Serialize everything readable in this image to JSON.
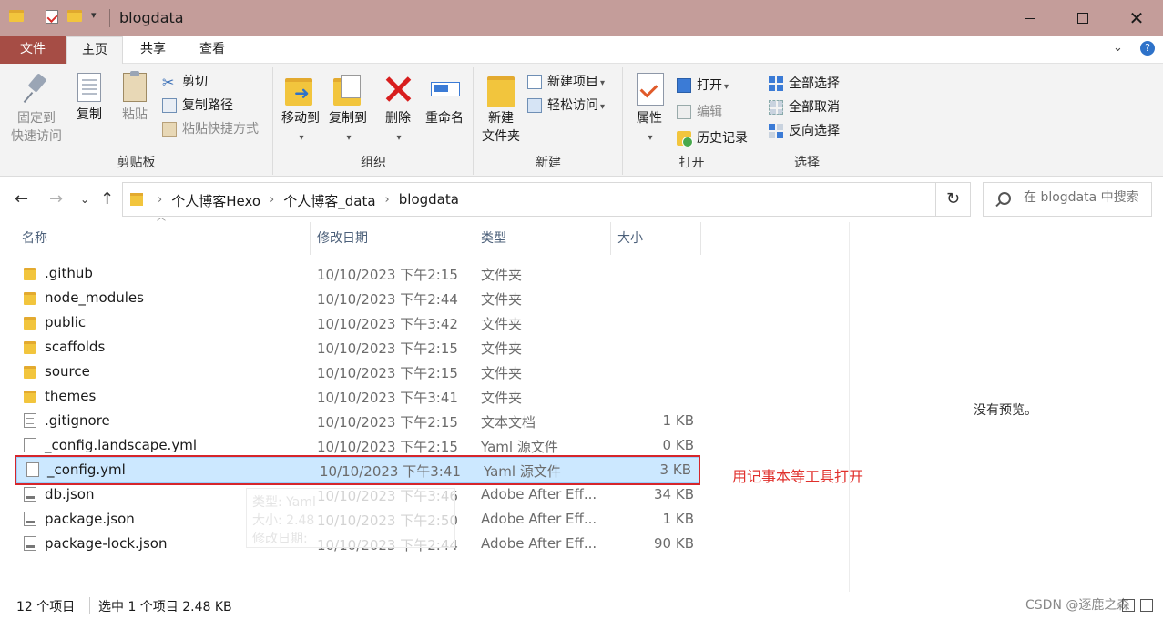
{
  "window": {
    "title": "blogdata",
    "close_glyph": "✕",
    "quick_access_down": "▾"
  },
  "tabs": {
    "file": "文件",
    "home": "主页",
    "share": "共享",
    "view": "查看"
  },
  "ribbon": {
    "clipboard": {
      "label": "剪贴板",
      "pin": "固定到\n快速访问",
      "pin_line1": "固定到",
      "pin_line2": "快速访问",
      "copy": "复制",
      "paste": "粘贴",
      "cut": "剪切",
      "copy_path": "复制路径",
      "paste_shortcut": "粘贴快捷方式"
    },
    "organize": {
      "label": "组织",
      "move_to": "移动到",
      "copy_to": "复制到",
      "delete": "删除",
      "rename": "重命名"
    },
    "new": {
      "label": "新建",
      "new_folder_line1": "新建",
      "new_folder_line2": "文件夹",
      "new_item": "新建项目",
      "easy_access": "轻松访问"
    },
    "open": {
      "label": "打开",
      "properties": "属性",
      "open": "打开",
      "edit": "编辑",
      "history": "历史记录"
    },
    "select": {
      "label": "选择",
      "select_all": "全部选择",
      "select_none": "全部取消",
      "invert": "反向选择"
    }
  },
  "address": {
    "crumbs": [
      "个人博客Hexo",
      "个人博客_data",
      "blogdata"
    ],
    "search_placeholder": "在 blogdata 中搜索"
  },
  "columns": {
    "name": "名称",
    "date": "修改日期",
    "type": "类型",
    "size": "大小"
  },
  "files": [
    {
      "name": ".github",
      "date": "10/10/2023 下午2:15",
      "type": "文件夹",
      "size": "",
      "icon": "folder"
    },
    {
      "name": "node_modules",
      "date": "10/10/2023 下午2:44",
      "type": "文件夹",
      "size": "",
      "icon": "folder"
    },
    {
      "name": "public",
      "date": "10/10/2023 下午3:42",
      "type": "文件夹",
      "size": "",
      "icon": "folder"
    },
    {
      "name": "scaffolds",
      "date": "10/10/2023 下午2:15",
      "type": "文件夹",
      "size": "",
      "icon": "folder"
    },
    {
      "name": "source",
      "date": "10/10/2023 下午2:15",
      "type": "文件夹",
      "size": "",
      "icon": "folder"
    },
    {
      "name": "themes",
      "date": "10/10/2023 下午3:41",
      "type": "文件夹",
      "size": "",
      "icon": "folder"
    },
    {
      "name": ".gitignore",
      "date": "10/10/2023 下午2:15",
      "type": "文本文档",
      "size": "1 KB",
      "icon": "txt"
    },
    {
      "name": "_config.landscape.yml",
      "date": "10/10/2023 下午2:15",
      "type": "Yaml 源文件",
      "size": "0 KB",
      "icon": "yml"
    },
    {
      "name": "_config.yml",
      "date": "10/10/2023 下午3:41",
      "type": "Yaml 源文件",
      "size": "3 KB",
      "icon": "yml",
      "selected": true
    },
    {
      "name": "db.json",
      "date": "10/10/2023 下午3:46",
      "type": "Adobe After Eff...",
      "size": "34 KB",
      "icon": "json"
    },
    {
      "name": "package.json",
      "date": "10/10/2023 下午2:50",
      "type": "Adobe After Eff...",
      "size": "1 KB",
      "icon": "json"
    },
    {
      "name": "package-lock.json",
      "date": "10/10/2023 下午2:44",
      "type": "Adobe After Eff...",
      "size": "90 KB",
      "icon": "json"
    }
  ],
  "tooltip": {
    "type": "类型: Yaml",
    "size": "大小: 2.48",
    "date": "修改日期: "
  },
  "annotation": "用记事本等工具打开",
  "preview": "没有预览。",
  "status": {
    "count": "12 个项目",
    "selection": "选中 1 个项目  2.48 KB"
  },
  "watermark": "CSDN @逐鹿之森",
  "colors": {
    "titlebar": "#c49d9a",
    "file_tab": "#a64d45",
    "selection": "#cce8ff",
    "annotation": "#e0302c"
  }
}
